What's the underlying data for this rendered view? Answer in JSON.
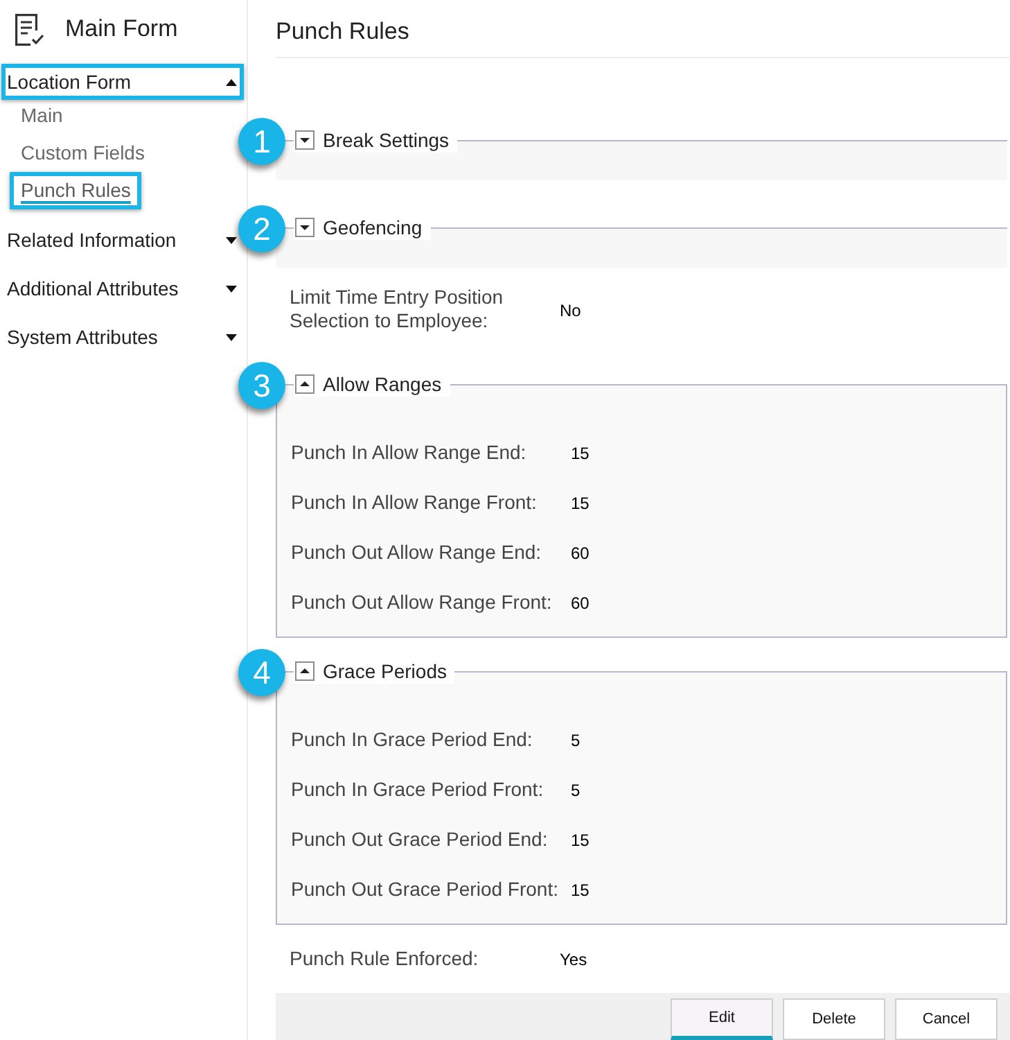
{
  "sidebar": {
    "title": "Main Form",
    "items": [
      {
        "label": "Location Form",
        "expanded": true,
        "highlighted": true,
        "children": [
          {
            "label": "Main",
            "selected": false,
            "highlighted": false
          },
          {
            "label": "Custom Fields",
            "selected": false,
            "highlighted": false
          },
          {
            "label": "Punch Rules",
            "selected": true,
            "highlighted": true
          }
        ]
      },
      {
        "label": "Related Information",
        "expanded": false,
        "highlighted": false
      },
      {
        "label": "Additional Attributes",
        "expanded": false,
        "highlighted": false
      },
      {
        "label": "System Attributes",
        "expanded": false,
        "highlighted": false
      }
    ]
  },
  "main": {
    "title": "Punch Rules",
    "content": [
      {
        "kind": "section",
        "callout": "1",
        "title": "Break Settings",
        "expanded": false
      },
      {
        "kind": "section",
        "callout": "2",
        "title": "Geofencing",
        "expanded": false
      },
      {
        "kind": "field",
        "label": "Limit Time Entry Position Selection to Employee:",
        "value": "No"
      },
      {
        "kind": "section",
        "callout": "3",
        "title": "Allow Ranges",
        "expanded": true,
        "fields": [
          {
            "label": "Punch In Allow Range End:",
            "value": "15"
          },
          {
            "label": "Punch In Allow Range Front:",
            "value": "15"
          },
          {
            "label": "Punch Out Allow Range End:",
            "value": "60"
          },
          {
            "label": "Punch Out Allow Range Front:",
            "value": "60"
          }
        ]
      },
      {
        "kind": "section",
        "callout": "4",
        "title": "Grace Periods",
        "expanded": true,
        "fields": [
          {
            "label": "Punch In Grace Period End:",
            "value": "5"
          },
          {
            "label": "Punch In Grace Period Front:",
            "value": "5"
          },
          {
            "label": "Punch Out Grace Period End:",
            "value": "15"
          },
          {
            "label": "Punch Out Grace Period Front:",
            "value": "15"
          }
        ]
      },
      {
        "kind": "field",
        "label": "Punch Rule Enforced:",
        "value": "Yes"
      }
    ]
  },
  "buttons": [
    {
      "label": "Edit",
      "active": true
    },
    {
      "label": "Delete",
      "active": false
    },
    {
      "label": "Cancel",
      "active": false
    }
  ]
}
